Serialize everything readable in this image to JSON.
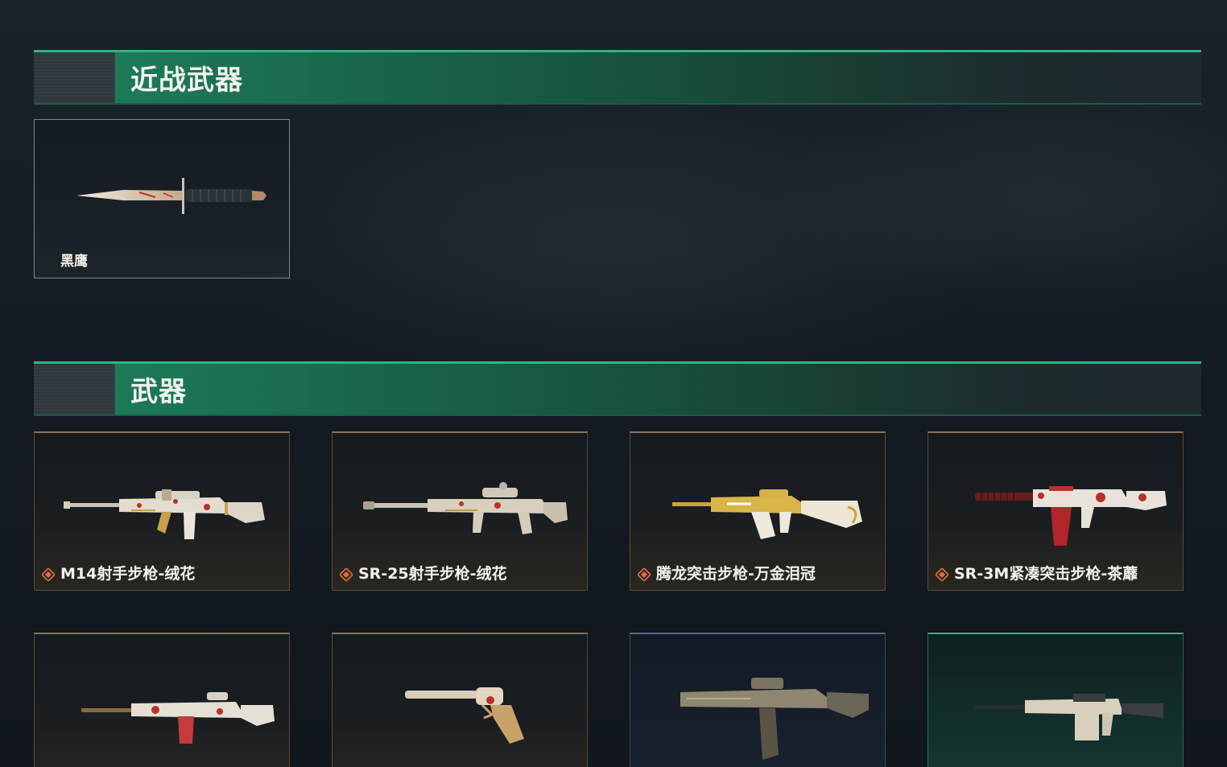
{
  "sections": {
    "melee": {
      "title": "近战武器"
    },
    "weapons": {
      "title": "武器"
    }
  },
  "melee_items": [
    {
      "name": "黑鹰",
      "icon": "knife-icon"
    }
  ],
  "weapon_items": [
    {
      "name": "M14射手步枪-绒花",
      "icon": "marksman-rifle-icon",
      "rarity_icon": "rarity-diamond-icon",
      "rarity_color": "#e0703a"
    },
    {
      "name": "SR-25射手步枪-绒花",
      "icon": "marksman-rifle-icon",
      "rarity_icon": "rarity-diamond-icon",
      "rarity_color": "#e0703a"
    },
    {
      "name": "腾龙突击步枪-万金泪冠",
      "icon": "assault-rifle-icon",
      "rarity_icon": "rarity-diamond-icon",
      "rarity_color": "#e0703a"
    },
    {
      "name": "SR-3M紧凑突击步枪-茶蘼",
      "icon": "compact-rifle-icon",
      "rarity_icon": "rarity-diamond-icon",
      "rarity_color": "#e0703a"
    },
    {
      "name": "",
      "icon": "rifle-icon"
    },
    {
      "name": "",
      "icon": "revolver-icon"
    },
    {
      "name": "",
      "icon": "smg-icon"
    },
    {
      "name": "",
      "icon": "machine-gun-icon",
      "rarity_color": "#2fd0a0"
    }
  ],
  "colors": {
    "accent_green": "#2fb483",
    "rarity_orange": "#e0703a",
    "rarity_teal": "#2fd0a0"
  }
}
